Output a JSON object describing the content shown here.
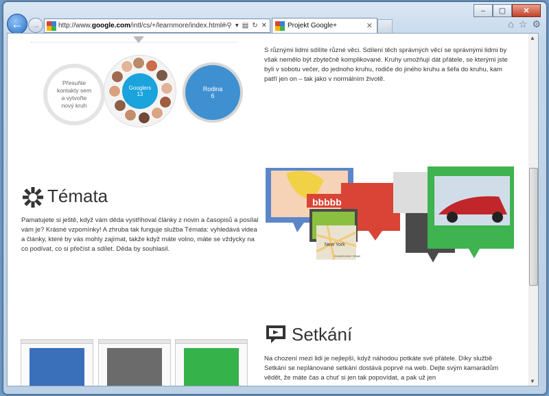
{
  "browser": {
    "address_url_prefix": "http://www.",
    "address_url_bold": "google.com",
    "address_url_suffix": "/intl/cs/+/learnmore/index.html#cir",
    "tab_title": "Projekt Google+",
    "tab_close": "✕",
    "icons": [
      "back-icon",
      "forward-icon",
      "search-icon",
      "refresh-icon",
      "stop-icon",
      "home-icon",
      "favorites-icon",
      "gear-icon"
    ]
  },
  "circles": {
    "empty_label": "Přesuňte kontakty sem a vytvořte nový kruh",
    "googlers_name": "Googlers",
    "googlers_count": "13",
    "rodina_name": "Rodina",
    "rodina_count": "6",
    "description": "S různými lidmi sdílíte různé věci. Sdílení těch správných věcí se správnými lidmi by však nemělo být zbytečně komplikované. Kruhy umožňují dát přátele, se kterými jste byli v sobotu večer, do jednoho kruhu, rodiče do jiného kruhu a šéfa do kruhu, kam patří jen on – tak jako v normálním životě."
  },
  "temata": {
    "title": "Témata",
    "description": "Pamatujete si ještě, když vám děda vystřihoval články z novin a časopisů a posílal vám je? Krásné vzpomínky! A zhruba tak funguje služba Témata: vyhledává videa a články, které by vás mohly zajímat, takže když máte volno, máte se vždycky na co podívat, co si přečíst a sdílet. Děda by souhlasil."
  },
  "collage": {
    "comic_text": "bbbbb",
    "map_label": "New York",
    "map_small": "Knickerbocker Village"
  },
  "setkani": {
    "title": "Setkání",
    "description": "Na chození mezi lidi je nejlepší, když náhodou potkáte své přátele. Díky službě Setkání se neplánované setkání dostává poprvé na web. Dejte svým kamarádům vědět, že máte čas a chuť si jen tak popovídat, a pak už jen"
  },
  "colors": {
    "googlers": "#1aa3dc",
    "rodina": "#3f90d1",
    "collage_blue": "#5c86c8",
    "collage_red": "#d94436",
    "collage_green": "#3eb34f",
    "collage_dark": "#4a4a4a"
  }
}
